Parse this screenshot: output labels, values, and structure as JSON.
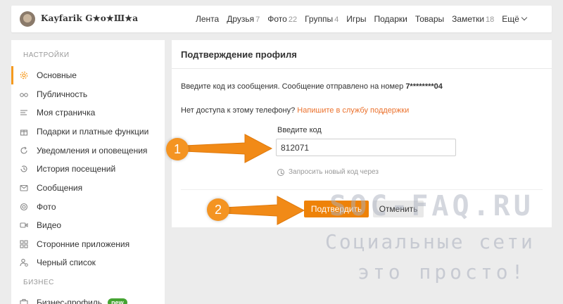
{
  "header": {
    "username": "Kayfarik G★ο★Ш★а",
    "nav": [
      {
        "label": "Лента",
        "count": ""
      },
      {
        "label": "Друзья",
        "count": "7"
      },
      {
        "label": "Фото",
        "count": "22"
      },
      {
        "label": "Группы",
        "count": "4"
      },
      {
        "label": "Игры",
        "count": ""
      },
      {
        "label": "Подарки",
        "count": ""
      },
      {
        "label": "Товары",
        "count": ""
      },
      {
        "label": "Заметки",
        "count": "18"
      }
    ],
    "more_label": "Ещё"
  },
  "sidebar": {
    "settings_title": "НАСТРОЙКИ",
    "items": [
      {
        "label": "Основные",
        "icon": "gear-icon",
        "active": true
      },
      {
        "label": "Публичность",
        "icon": "glasses-icon"
      },
      {
        "label": "Моя страничка",
        "icon": "lines-icon"
      },
      {
        "label": "Подарки и платные функции",
        "icon": "gift-icon"
      },
      {
        "label": "Уведомления и оповещения",
        "icon": "refresh-icon"
      },
      {
        "label": "История посещений",
        "icon": "history-icon"
      },
      {
        "label": "Сообщения",
        "icon": "envelope-icon"
      },
      {
        "label": "Фото",
        "icon": "camera-icon"
      },
      {
        "label": "Видео",
        "icon": "video-icon"
      },
      {
        "label": "Сторонние приложения",
        "icon": "apps-icon"
      },
      {
        "label": "Черный список",
        "icon": "user-block-icon"
      }
    ],
    "business_title": "БИЗНЕС",
    "business_item": {
      "label": "Бизнес-профиль",
      "badge": "new"
    }
  },
  "panel": {
    "title": "Подтверждение профиля",
    "message_prefix": "Введите код из сообщения. Сообщение отправлено на номер ",
    "phone": "7********04",
    "noaccess_prefix": "Нет доступа к этому телефону? ",
    "support_link": "Напишите в службу поддержки",
    "code_label": "Введите код",
    "code_value": "812071",
    "resend_text": "Запросить новый код через",
    "confirm_label": "Подтвердить",
    "cancel_label": "Отменить"
  },
  "annotations": {
    "marker1": "1",
    "marker2": "2",
    "accent_color": "#f49422"
  },
  "watermark": {
    "line1": "SOC-FAQ.RU",
    "line2": "Социальные сети",
    "line3": "это просто!"
  }
}
